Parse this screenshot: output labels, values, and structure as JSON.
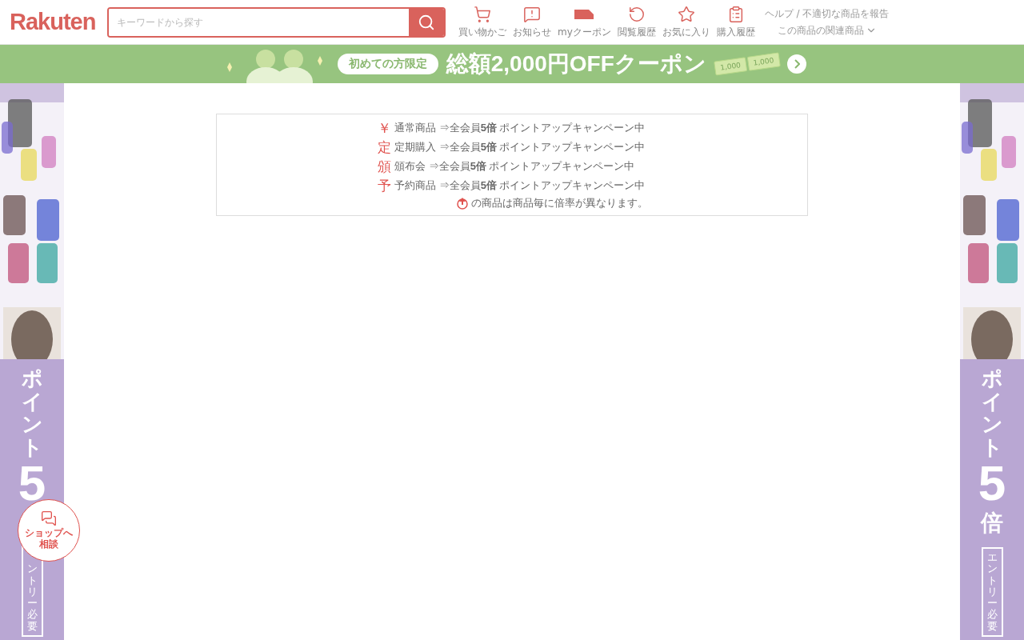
{
  "header": {
    "logo": "Rakuten",
    "search": {
      "placeholder": "キーワードから探す"
    },
    "nav": [
      {
        "kind": "cart",
        "label": "買い物かご"
      },
      {
        "kind": "notice",
        "label": "お知らせ"
      },
      {
        "kind": "coupon",
        "label": "myクーポン"
      },
      {
        "kind": "history",
        "label": "閲覧履歴"
      },
      {
        "kind": "star",
        "label": "お気に入り"
      },
      {
        "kind": "list",
        "label": "購入履歴"
      }
    ],
    "links": [
      "ヘルプ / 不適切な商品を報告",
      "この商品の関連商品"
    ]
  },
  "promo_banner": {
    "badge": "初めての方限定",
    "headline": "総額2,000円OFFクーポン",
    "tickets": [
      "1,000",
      "1,000"
    ]
  },
  "point_notice": [
    {
      "mark": "￥",
      "text": "通常商品 ⇒全会員**5倍**  ポイントアップキャンペーン中"
    },
    {
      "mark": "定",
      "text": "定期購入 ⇒全会員**5倍**  ポイントアップキャンペーン中"
    },
    {
      "mark": "頒",
      "text": "頒布会 ⇒全会員**5倍**  ポイントアップキャンペーン中"
    },
    {
      "mark": "予",
      "text": "予約商品 ⇒全会員**5倍**  ポイントアップキャンペーン中"
    }
  ],
  "point_note": "の商品は商品毎に倍率が異なります。",
  "side_banners": [
    {
      "title": "ポイント",
      "number": "5",
      "entry": "ントリー必要"
    },
    {
      "title": "ポイント",
      "number": "5",
      "unit": "倍",
      "entry": "エントリー必要"
    }
  ],
  "chat_button": {
    "label": "ショップへ相談"
  }
}
